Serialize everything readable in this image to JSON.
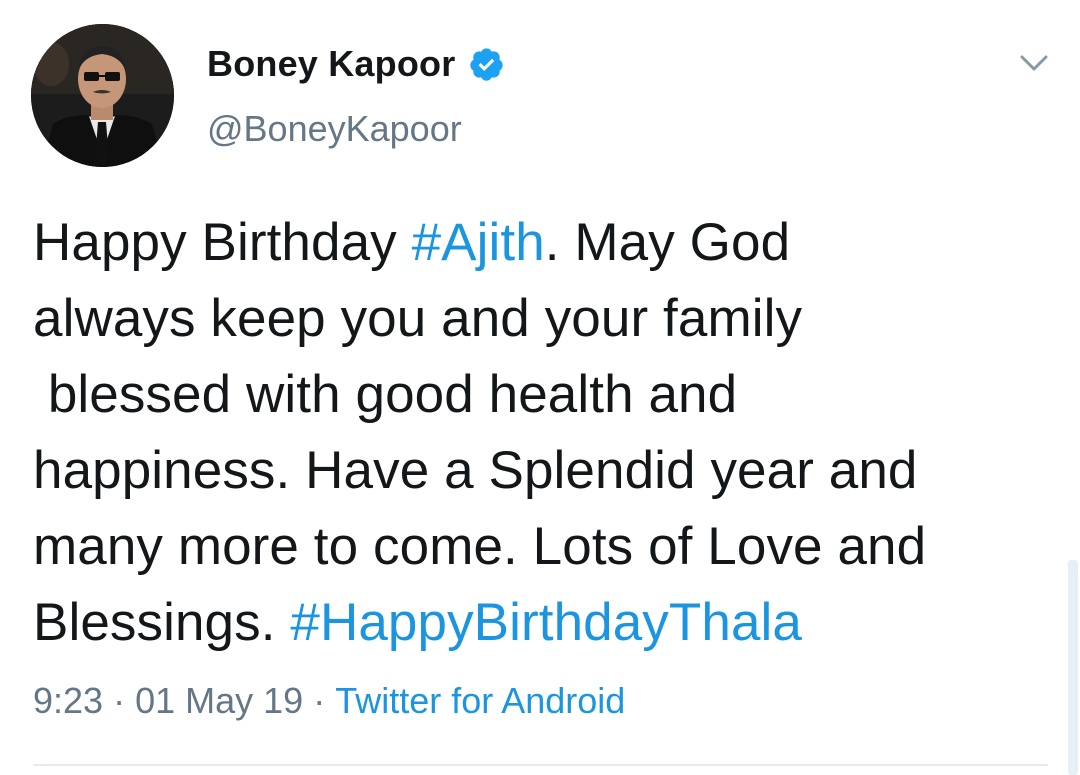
{
  "tweet": {
    "author": {
      "display_name": "Boney Kapoor",
      "handle": "@BoneyKapoor",
      "verified": true,
      "avatar_icon": "profile-photo"
    },
    "text_segments": [
      {
        "type": "text",
        "value": "Happy Birthday "
      },
      {
        "type": "hashtag",
        "value": "#Ajith"
      },
      {
        "type": "text",
        "value": ". May God\nalways keep you and your family\n blessed with good health and\nhappiness. Have a Splendid year and\nmany more to come. Lots of Love and\nBlessings. "
      },
      {
        "type": "hashtag",
        "value": "#HappyBirthdayThala"
      }
    ],
    "time": "9:23",
    "date": "01 May 19",
    "separator": "·",
    "source": "Twitter for Android"
  },
  "colors": {
    "link": "#1b95e0",
    "text": "#14171a",
    "muted": "#657786",
    "verified_badge": "#1da1f2"
  },
  "icons": {
    "menu": "chevron-down-icon",
    "verified": "verified-badge-icon"
  }
}
